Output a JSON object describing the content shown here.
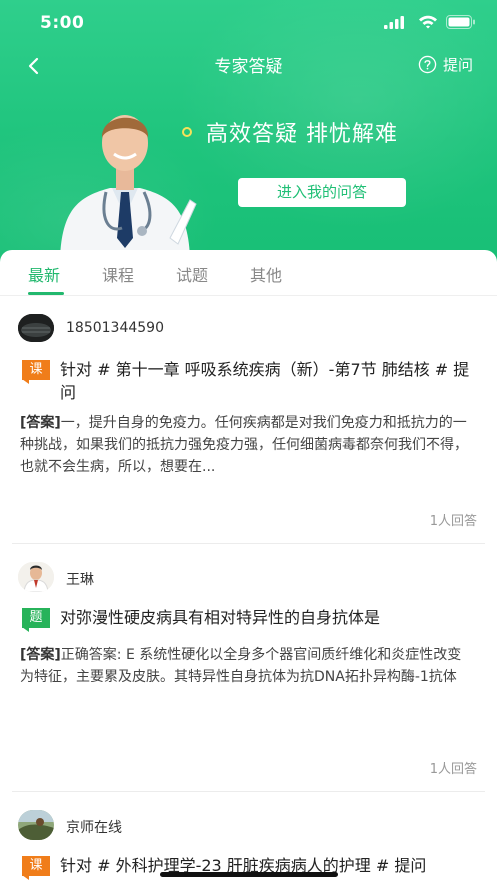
{
  "status_bar": {
    "time": "5:00"
  },
  "nav": {
    "title": "专家答疑",
    "ask_label": "提问"
  },
  "hero": {
    "slogan": "高效答疑 排忧解难",
    "enter_button": "进入我的问答"
  },
  "tabs": [
    {
      "label": "最新",
      "active": true
    },
    {
      "label": "课程",
      "active": false
    },
    {
      "label": "试题",
      "active": false
    },
    {
      "label": "其他",
      "active": false
    }
  ],
  "posts": [
    {
      "user": "18501344590",
      "tag": "课",
      "tag_color": "#f07d1a",
      "question": "针对 # 第十一章 呼吸系统疾病（新）-第7节 肺结核 # 提问",
      "answer_prefix": "[答案]",
      "answer": "一，提升自身的免疫力。任何疾病都是对我们免疫力和抵抗力的一种挑战，如果我们的抵抗力强免疫力强，任何细菌病毒都奈何我们不得，也就不会生病，所以，想要在...",
      "count": "1人回答"
    },
    {
      "user": "王琳",
      "tag": "题",
      "tag_color": "#27b35a",
      "question": "对弥漫性硬皮病具有相对特异性的自身抗体是",
      "answer_prefix": "[答案]",
      "answer": "正确答案: E 系统性硬化以全身多个器官间质纤维化和炎症性改变为特征，主要累及皮肤。其特异性自身抗体为抗DNA拓扑异构酶-1抗体",
      "count": "1人回答"
    },
    {
      "user": "京师在线",
      "tag": "课",
      "tag_color": "#f07d1a",
      "question": "针对 # 外科护理学-23 肝脏疾病病人的护理 # 提问"
    }
  ],
  "colors": {
    "primary": "#22b86e",
    "hero": "#1fc47d"
  }
}
